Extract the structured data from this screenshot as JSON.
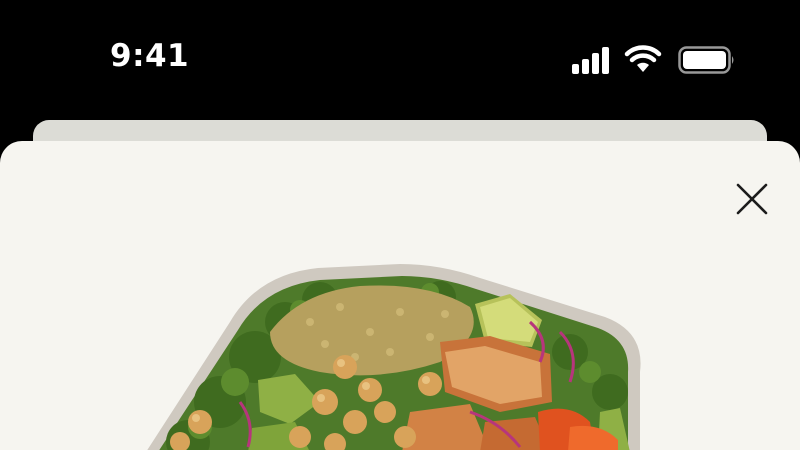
{
  "status_bar": {
    "time": "9:41",
    "icons": [
      "cellular-signal-icon",
      "wifi-icon",
      "battery-icon"
    ]
  },
  "sheet": {
    "close_icon": "close-icon",
    "image": "salad-bowl-image"
  },
  "colors": {
    "status_bar_bg": "#000000",
    "sheet_bg": "#f6f5f0",
    "sheet_back_bg": "#dcdcd6",
    "icon": "#1c1c1c"
  }
}
